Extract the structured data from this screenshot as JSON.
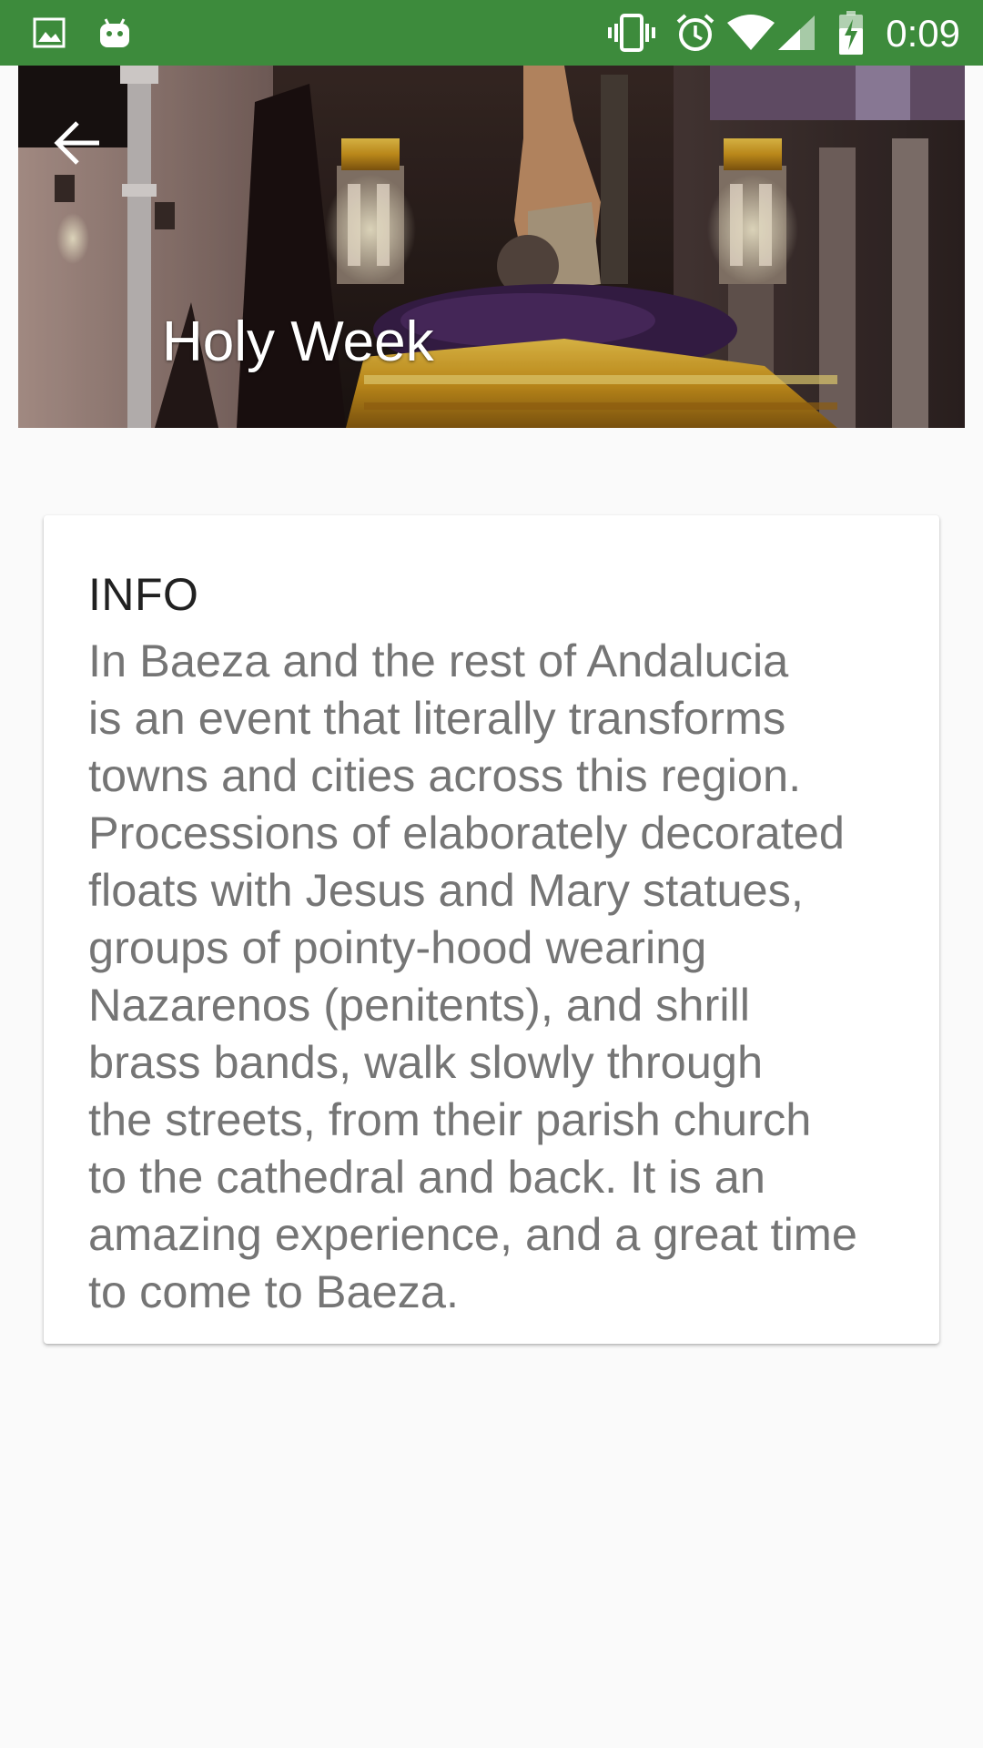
{
  "status_bar": {
    "time": "0:09",
    "background_color": "#3d8b3c",
    "left_icons": [
      "gallery-notification-icon",
      "android-notification-icon"
    ],
    "right_icons": [
      "vibrate-icon",
      "alarm-icon",
      "wifi-icon",
      "cell-signal-icon",
      "battery-charging-icon"
    ]
  },
  "header": {
    "title": "Holy Week",
    "back_icon": "arrow-back-icon",
    "image_description_icon": "procession-float-photo"
  },
  "info": {
    "title": "INFO",
    "lines": [
      "In Baeza and the rest of Andalucia",
      "is an event that literally transforms",
      "towns and cities across this region.",
      "Processions of elaborately decorated",
      "floats with Jesus and Mary statues,",
      "groups of pointy-hood wearing",
      "Nazarenos (penitents), and shrill",
      "brass bands, walk slowly through",
      "the streets, from their parish church",
      "to the cathedral and back. It is an",
      "amazing experience, and a great time",
      "to come to Baeza."
    ]
  }
}
